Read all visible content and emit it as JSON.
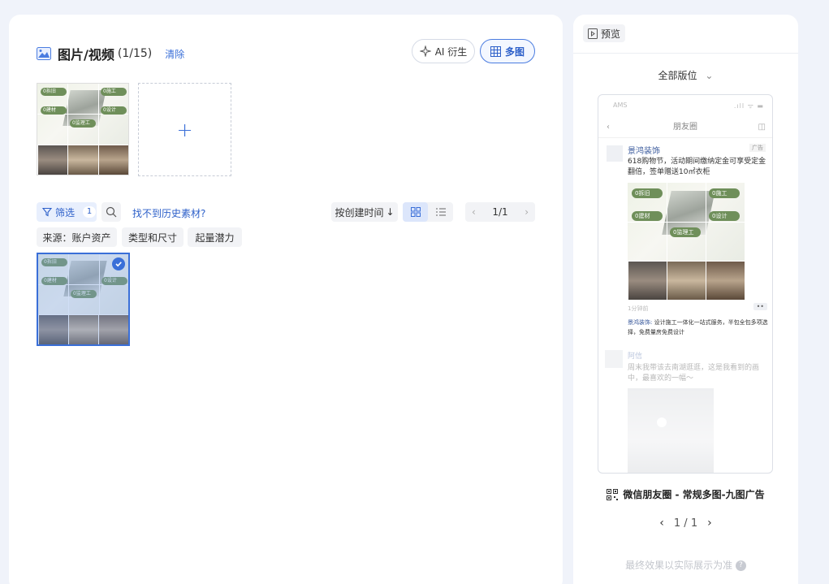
{
  "media": {
    "title": "图片/视频",
    "count": "(1/15)",
    "clear_label": "清除",
    "ai_button": "AI 衍生",
    "multi_button": "多图",
    "add_label": "+"
  },
  "tags": {
    "t1": "0拆旧",
    "t2": "0施工",
    "t3": "0建材",
    "t4": "0设计",
    "t5": "0监理工"
  },
  "filters": {
    "filter_label": "筛选",
    "filter_count": "1",
    "history_link": "找不到历史素材?",
    "sort_label": "按创建时间",
    "sort_arrow": "↓",
    "page": "1/1",
    "chips": [
      "来源：账户资产",
      "类型和尺寸",
      "起量潜力"
    ]
  },
  "preview": {
    "tab_label": "预览",
    "version_select": "全部版位",
    "phone": {
      "status_left": "AMS",
      "status_right": ".ıll ᯤ ▬",
      "nav_title": "朋友圈",
      "brand": "景鸿装饰",
      "ad_badge": "广告",
      "ad_text": "618购物节，活动期间缴纳定金可享受定金翻倍，签单赠送10㎡衣柜",
      "time": "1分钟前",
      "dots": "••",
      "comment_name": "景鸿装饰:",
      "comment_text": "设计施工一体化一站式服务，半包全包多项选择，免费量房免费设计",
      "friend_name": "阿信",
      "friend_text": "周末我带该去南湖逛逛，这是我看到的画中，最喜欢的一幅～"
    },
    "ad_title": "微信朋友圈 - 常规多图-九图广告",
    "pager": "1 / 1",
    "footnote": "最终效果以实际展示为准"
  },
  "colors": {
    "accent": "#3a6fd8",
    "tag_green": "#6f8f5a"
  }
}
